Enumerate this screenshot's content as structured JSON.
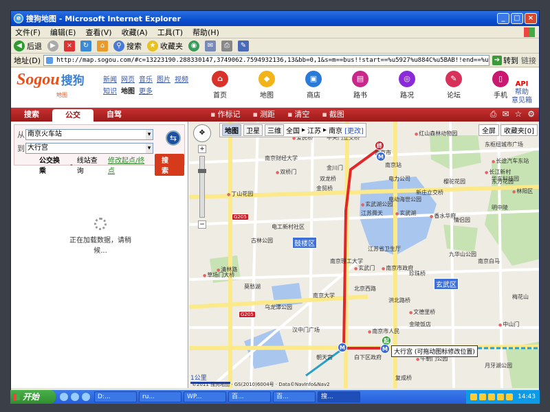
{
  "window": {
    "title": "搜狗地图 - Microsoft Internet Explorer",
    "min": "_",
    "max": "□",
    "close": "×"
  },
  "menu": [
    "文件(F)",
    "编辑(E)",
    "查看(V)",
    "收藏(A)",
    "工具(T)",
    "帮助(H)"
  ],
  "toolbar": {
    "back": "后退",
    "search": "搜索",
    "favorites": "收藏夹"
  },
  "address": {
    "label": "地址(D)",
    "url": "http://map.sogou.com/#c=13223190.288330147,3749062.7594932136,13&bb=0,1&s=m==bus!!start==%u5927%u884C%u5BAB!!end==%u5357%u4EAC%u706B%u8F66",
    "go": "转到",
    "links": "链接"
  },
  "sogou": {
    "logo_text": "Sogou",
    "logo_cn": "搜狗",
    "logo_sub": "地图",
    "channels": [
      "新闻",
      "网页",
      "音乐",
      "图片",
      "视频",
      "知识",
      "地图",
      "更多"
    ],
    "current_channel": "地图",
    "nav": [
      {
        "label": "首页",
        "color": "#d8322a",
        "glyph": "⌂"
      },
      {
        "label": "地图",
        "color": "#f2b418",
        "glyph": "◆"
      },
      {
        "label": "商店",
        "color": "#2a7ad8",
        "glyph": "▣"
      },
      {
        "label": "路书",
        "color": "#c8288a",
        "glyph": "▤"
      },
      {
        "label": "路况",
        "color": "#8a2ad8",
        "glyph": "◎"
      },
      {
        "label": "论坛",
        "color": "#d8325a",
        "glyph": "✎"
      },
      {
        "label": "手机",
        "color": "#c81870",
        "glyph": "▯"
      }
    ],
    "api": "API",
    "help": "帮助",
    "feedback": "意见箱"
  },
  "tabs": [
    "搜索",
    "公交",
    "自驾"
  ],
  "active_tab": "公交",
  "maptools": [
    "作标记",
    "测距",
    "清空",
    "截图"
  ],
  "rtools": [
    "⎙",
    "✉",
    "☆",
    "⚙"
  ],
  "query": {
    "from_label": "从",
    "from_value": "南京火车站",
    "to_label": "到",
    "to_value": "大行宫",
    "swap": "⇆",
    "transfer": "公交换乘",
    "station_query": "线站查询",
    "modify": "修改起点/终点",
    "search_btn": "搜 索"
  },
  "loading": "正在加载数据，请稍候...",
  "mapnav": {
    "modes": [
      "地图",
      "卫星",
      "三维"
    ],
    "active": "地图",
    "crumbs": [
      "全国",
      "江苏",
      "南京"
    ],
    "change": "[更改]"
  },
  "fullscreen": "全屏",
  "favorites_btn": "收藏夹[0]",
  "map": {
    "districts": [
      "鼓楼区",
      "玄武区"
    ],
    "highways": [
      "G205",
      "G205"
    ],
    "labels": [
      "爱民桥",
      "中央门立交桥",
      "南京站",
      "红山森林动物园",
      "东枢纽城市广场",
      "南京财经大学",
      "双桥门",
      "金川门",
      "电力公司",
      "长途汽车东站",
      "南京市",
      "双龙桥",
      "长江新村",
      "华东科技园",
      "东方花园",
      "玄武湖",
      "新庄立交桥",
      "樱驼花园",
      "丁山花园",
      "金贸桥",
      "电动海世公园",
      "林阳区",
      "江苏舜天",
      "南京理工大学",
      "香水华府",
      "明中陵",
      "电工新村社区",
      "玄武湖公园",
      "莫愁湖",
      "情侣园",
      "清林路",
      "古林公园",
      "江苏省卫生厅",
      "南京市政府",
      "九华山公园",
      "南京白马",
      "草场门大桥",
      "北京西路",
      "珍珠桥",
      "玄武门",
      "南京大学",
      "洪北路桥",
      "文德里桥",
      "汉中门广场",
      "朝天宫",
      "南京市人民",
      "乌龙潭公园",
      "梅花山",
      "中山门",
      "白下区政府",
      "复成桥",
      "午朝门公园",
      "月牙湖公园",
      "金陵饭店"
    ],
    "start_pin": "起",
    "end_pin": "终",
    "callout": "大行宫 (可拖动图标修改位置)",
    "scale": "1公里",
    "copyright": "©2011 搜狗地图 · GS(2010)6004号 · Data©NavInfo&Nav2"
  },
  "taskbar": {
    "start": "开始",
    "tasks": [
      "D:...",
      "ru...",
      "WP...",
      "百...",
      "百...",
      "搜..."
    ],
    "active_task": 5,
    "clock": "14:43"
  },
  "colors": {
    "route": "#e0282a",
    "water": "#a9c6ee",
    "park": "#c7e3b4",
    "road": "#ffffff",
    "major_road": "#fbe98a",
    "accent": "#b02020"
  }
}
